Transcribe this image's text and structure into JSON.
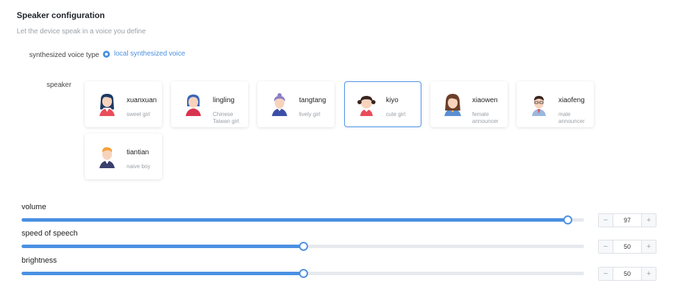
{
  "header": {
    "title": "Speaker configuration",
    "subtitle": "Let the device speak in a voice you define"
  },
  "voice_type": {
    "label": "synthesized voice type",
    "option": "local synthesized voice"
  },
  "speaker": {
    "label": "speaker",
    "cards": [
      {
        "name": "xuanxuan",
        "desc": "sweet girl"
      },
      {
        "name": "lingling",
        "desc": "Chinese Taiwan girl"
      },
      {
        "name": "tangtang",
        "desc": "lively girl"
      },
      {
        "name": "kiyo",
        "desc": "cute girl",
        "selected": true
      },
      {
        "name": "xiaowen",
        "desc": "female announcer"
      },
      {
        "name": "xiaofeng",
        "desc": "male announcer"
      },
      {
        "name": "tiantian",
        "desc": "naive boy"
      }
    ]
  },
  "sliders": [
    {
      "label": "volume",
      "value": 97,
      "min": 0,
      "max": 100,
      "minus": "−",
      "plus": "+"
    },
    {
      "label": "speed of speech",
      "value": 50,
      "min": 0,
      "max": 100,
      "minus": "−",
      "plus": "+"
    },
    {
      "label": "brightness",
      "value": 50,
      "min": 0,
      "max": 100,
      "minus": "−",
      "plus": "+"
    }
  ],
  "colors": {
    "accent": "#4a90e2",
    "track": "#e6e9ee"
  }
}
